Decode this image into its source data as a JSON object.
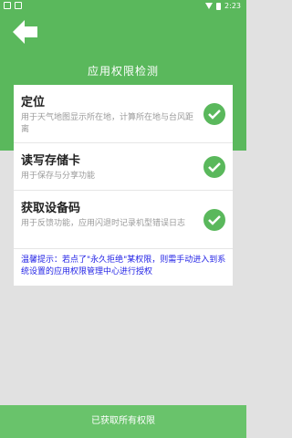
{
  "statusbar": {
    "time": "2:23"
  },
  "header": {
    "title": "应用权限检测"
  },
  "permissions": [
    {
      "name": "定位",
      "desc": "用于天气地图显示所在地，计算所在地与台风距离"
    },
    {
      "name": "读写存储卡",
      "desc": "用于保存与分享功能"
    },
    {
      "name": "获取设备码",
      "desc": "用于反馈功能，应用闪退时记录机型错误日志"
    }
  ],
  "tip": "温馨提示：若点了\"永久拒绝\"某权限，则需手动进入到系统设置的应用权限管理中心进行授权",
  "footer": {
    "button_label": "已获取所有权限"
  },
  "colors": {
    "accent": "#5ab85c",
    "tip": "#2424e6"
  }
}
